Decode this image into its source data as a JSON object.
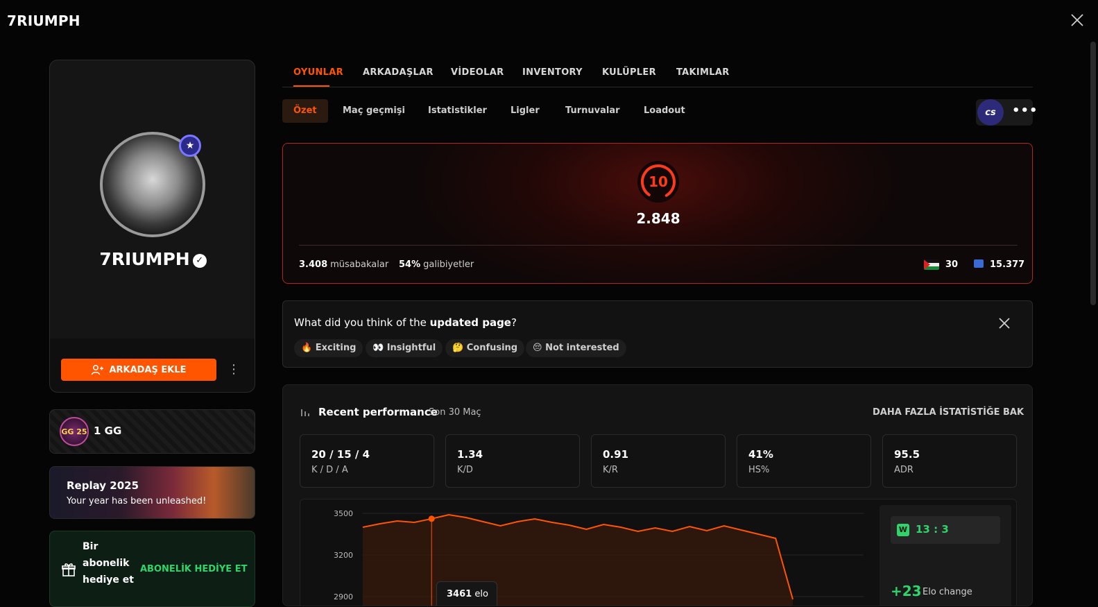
{
  "app": {
    "title": "7RIUMPH"
  },
  "profile": {
    "name": "7RIUMPH",
    "add_friend_label": "ARKADAŞ EKLE"
  },
  "gg": {
    "label": "1 GG",
    "logo_text": "GG 25"
  },
  "replay": {
    "title": "Replay 2025",
    "subtitle": "Your year has been unleashed!"
  },
  "gift": {
    "text": "Bir abonelik hediye et",
    "action": "ABONELİK HEDİYE ET"
  },
  "tabs": [
    {
      "label": "OYUNLAR",
      "active": true
    },
    {
      "label": "ARKADAŞLAR"
    },
    {
      "label": "VİDEOLAR"
    },
    {
      "label": "INVENTORY"
    },
    {
      "label": "KULÜPLER"
    },
    {
      "label": "TAKIMLAR"
    }
  ],
  "subtabs": [
    {
      "label": "Özet",
      "active": true
    },
    {
      "label": "Maç geçmişi"
    },
    {
      "label": "Istatistikler"
    },
    {
      "label": "Ligler"
    },
    {
      "label": "Turnuvalar"
    },
    {
      "label": "Loadout"
    }
  ],
  "game_logo": "cs",
  "summary": {
    "level": "10",
    "elo": "2.848",
    "matches_value": "3.408",
    "matches_label": "müsabakalar",
    "winrate_value": "54%",
    "winrate_label": "galibiyetler",
    "country_rank": "30",
    "region_rank": "15.377",
    "accent_color": "#ff3a1a"
  },
  "feedback": {
    "question_prefix": "What did you think of the ",
    "question_bold": "updated page",
    "question_suffix": "?",
    "options": [
      {
        "emoji": "🔥",
        "label": "Exciting"
      },
      {
        "emoji": "👀",
        "label": "Insightful"
      },
      {
        "emoji": "🤔",
        "label": "Confusing"
      },
      {
        "emoji": "😔",
        "label": "Not interested"
      }
    ]
  },
  "performance": {
    "title": "Recent performance",
    "subtitle": "Son 30 Maç",
    "more_link": "DAHA FAZLA İSTATİSTİĞE BAK",
    "stats": [
      {
        "value": "20 / 15 / 4",
        "label": "K / D / A"
      },
      {
        "value": "1.34",
        "label": "K/D"
      },
      {
        "value": "0.91",
        "label": "K/R"
      },
      {
        "value": "41%",
        "label": "HS%"
      },
      {
        "value": "95.5",
        "label": "ADR"
      }
    ],
    "tooltip_value": "3461",
    "tooltip_unit": "elo",
    "match": {
      "result": "W",
      "score": "13 : 3",
      "elo_change": "+23",
      "elo_change_label": "Elo change"
    }
  },
  "chart_data": {
    "type": "area",
    "yticks": [
      "3500",
      "3200",
      "2900"
    ],
    "ylim": [
      2900,
      3500
    ],
    "values": [
      3400,
      3425,
      3445,
      3435,
      3461,
      3490,
      3470,
      3440,
      3410,
      3440,
      3460,
      3435,
      3415,
      3385,
      3420,
      3400,
      3370,
      3395,
      3370,
      3405,
      3375,
      3410,
      3380,
      3350,
      3320,
      2880
    ],
    "highlight_index": 4,
    "color": "#ff5500"
  }
}
